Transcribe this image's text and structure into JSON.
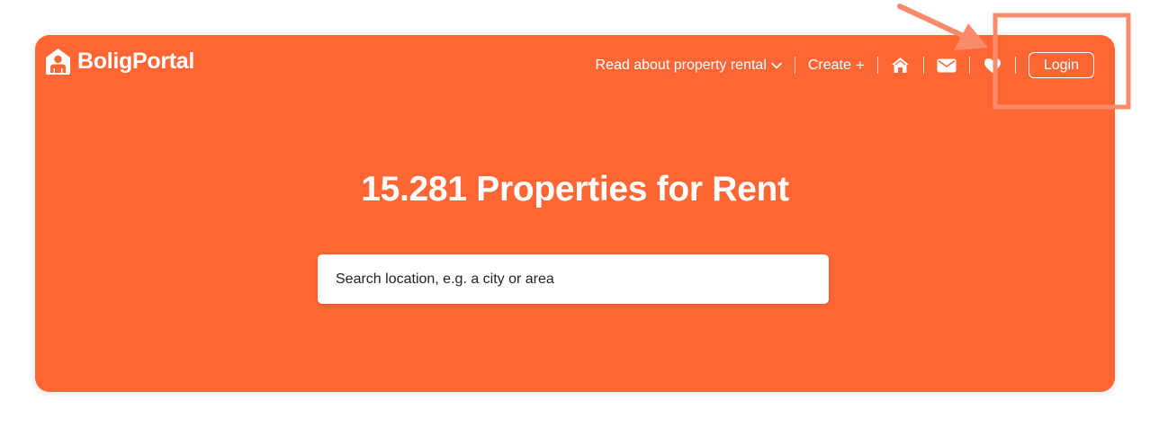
{
  "brand": {
    "name": "BoligPortal"
  },
  "nav": {
    "read_about": "Read about property rental",
    "create": "Create",
    "create_plus": "+",
    "login": "Login"
  },
  "icons": {
    "read_about_chevron": "chevron-down-icon",
    "create": "plus-icon",
    "home": "home-icon",
    "mail": "mail-icon",
    "favorites": "heart-icon"
  },
  "hero": {
    "headline": "15.281 Properties for Rent"
  },
  "search": {
    "placeholder": "Search location, e.g. a city or area"
  },
  "colors": {
    "brand_orange": "#ff6633",
    "annotation": "#f98b6a"
  }
}
